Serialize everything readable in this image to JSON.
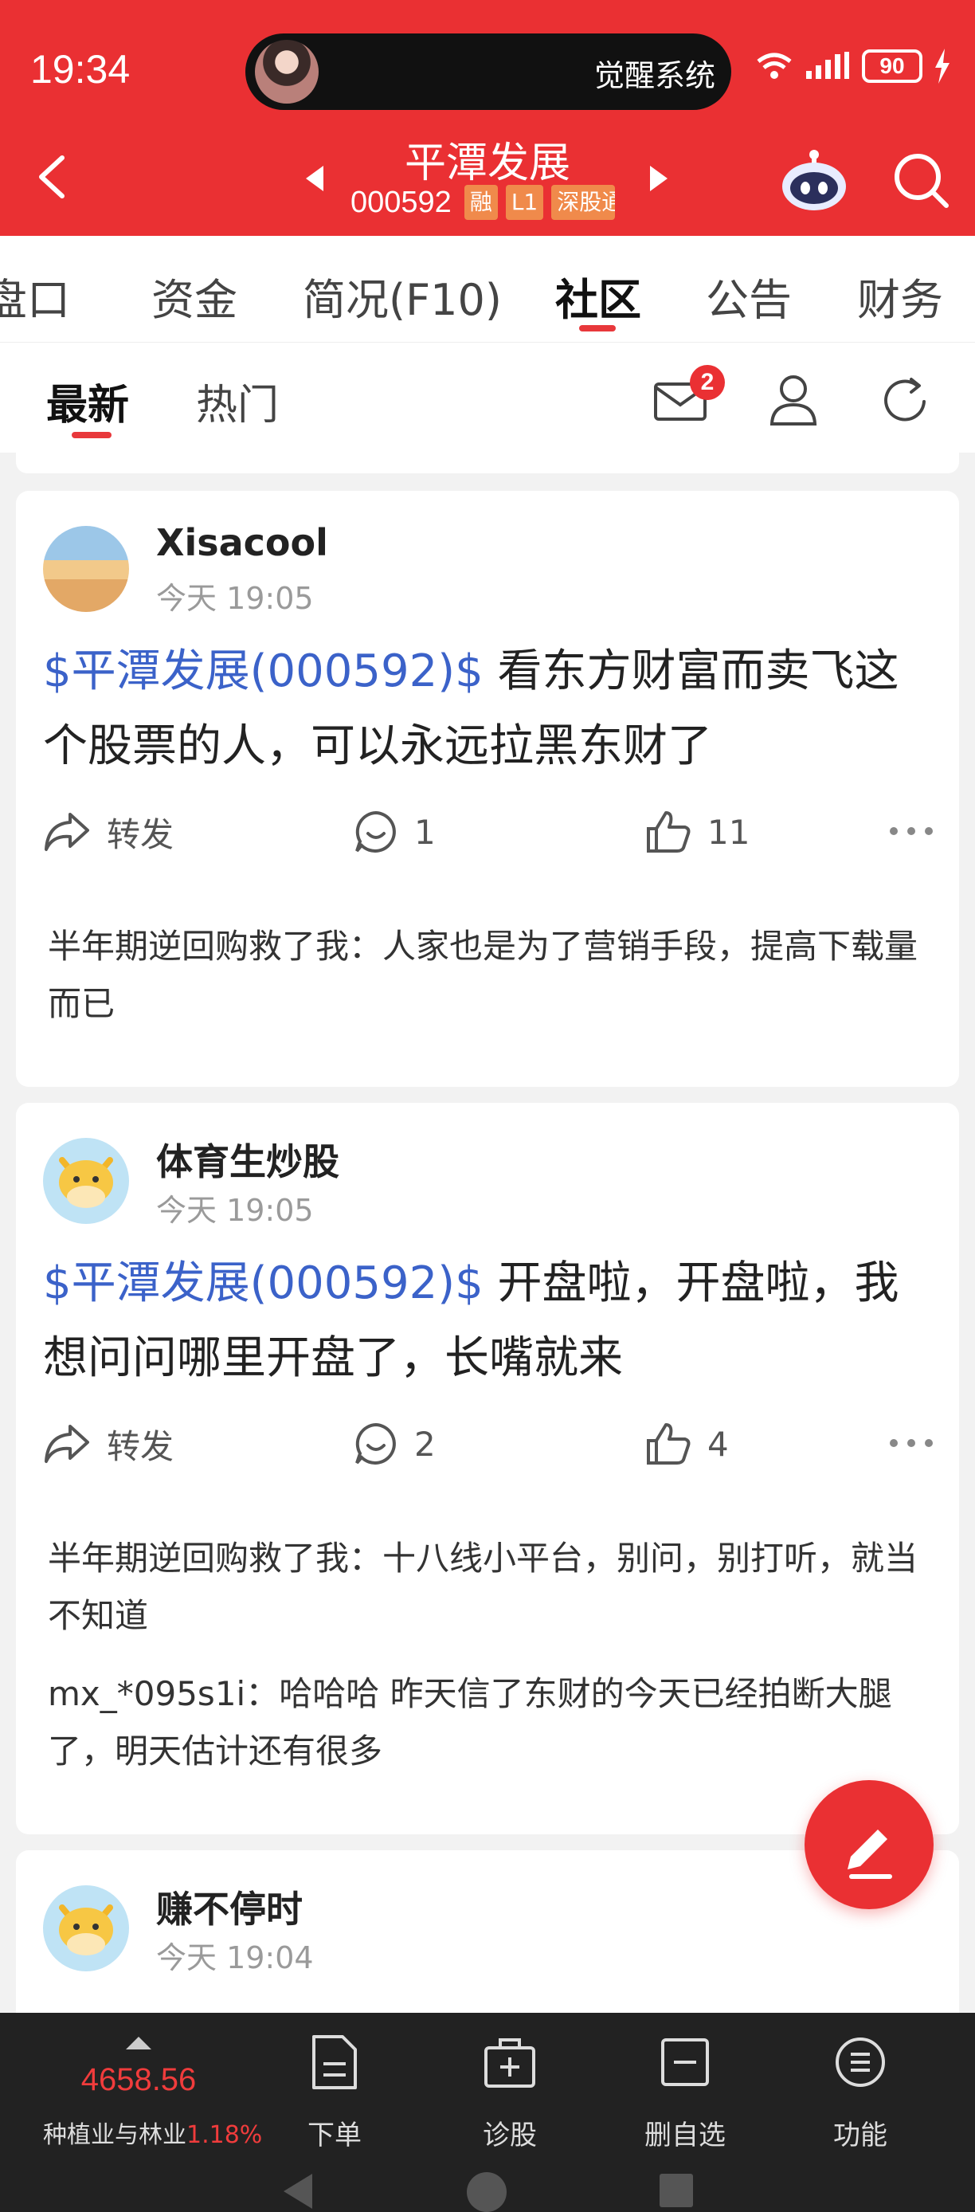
{
  "status_bar": {
    "time": "19:34",
    "island_text": "觉醒系统",
    "battery": "90"
  },
  "header": {
    "title": "平潭发展",
    "code": "000592",
    "tags": [
      "融",
      "L1",
      "深股通"
    ]
  },
  "tabs": [
    {
      "label": "盘口",
      "active": false
    },
    {
      "label": "资金",
      "active": false
    },
    {
      "label": "简况(F10)",
      "active": false
    },
    {
      "label": "社区",
      "active": true
    },
    {
      "label": "公告",
      "active": false
    },
    {
      "label": "财务",
      "active": false
    }
  ],
  "subtabs": {
    "latest": "最新",
    "hot": "热门",
    "mail_badge": "2"
  },
  "posts": [
    {
      "username": "Xisacool",
      "time": "今天 19:05",
      "stock_link": "$平潭发展(000592)$",
      "text": " 看东方财富而卖飞这个股票的人，可以永远拉黑东财了",
      "share_label": "转发",
      "comments": "1",
      "likes": "11",
      "replies": [
        {
          "author": "半年期逆回购救了我：",
          "text": "人家也是为了营销手段，提高下载量而已"
        }
      ]
    },
    {
      "username": "体育生炒股",
      "time": "今天 19:05",
      "stock_link": "$平潭发展(000592)$",
      "text": " 开盘啦，开盘啦，我想问问哪里开盘了，长嘴就来",
      "share_label": "转发",
      "comments": "2",
      "likes": "4",
      "replies": [
        {
          "author": "半年期逆回购救了我：",
          "text": "十八线小平台，别问，别打听，就当不知道"
        },
        {
          "author": "mx_*095s1i：",
          "text": "哈哈哈 昨天信了东财的今天已经拍断大腿了，明天估计还有很多"
        }
      ]
    },
    {
      "username": "赚不停时",
      "time": "今天 19:04"
    }
  ],
  "bottom_bar": {
    "index_value": "4658.56",
    "index_name": "种植业与林业",
    "index_pct": "1.18%",
    "buttons": [
      "下单",
      "诊股",
      "删自选",
      "功能"
    ]
  },
  "colors": {
    "brand_red": "#ea3033",
    "link_blue": "#3b62c9",
    "up_red": "#f03c3c"
  }
}
